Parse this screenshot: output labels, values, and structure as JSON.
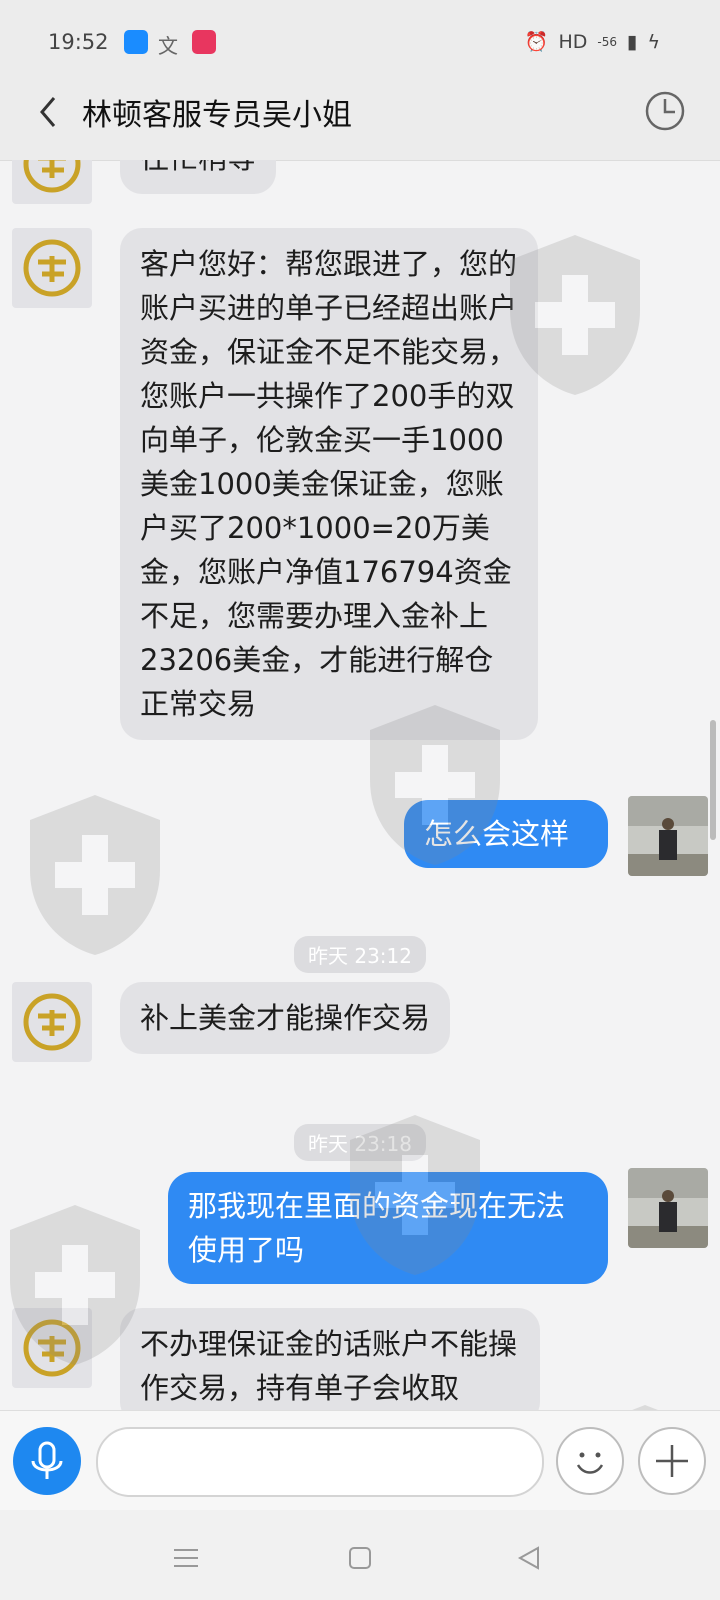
{
  "status_bar": {
    "time": "19:52",
    "right_text": "HD",
    "signal_text": "-56"
  },
  "header": {
    "title": "林顿客服专员吴小姐"
  },
  "messages": {
    "m0": {
      "text": "往忙稍等"
    },
    "m1": {
      "text": "客户您好：帮您跟进了，您的账户买进的单子已经超出账户资金，保证金不足不能交易，您账户一共操作了200手的双向单子，伦敦金买一手1000美金1000美金保证金，您账户买了200*1000=20万美金，您账户净值176794资金不足，您需要办理入金补上23206美金，才能进行解仓 正常交易"
    },
    "m2": {
      "text": "怎么会这样"
    },
    "t1": {
      "text": "昨天 23:12"
    },
    "m3": {
      "text": "补上美金才能操作交易"
    },
    "t2": {
      "text": "昨天 23:18"
    },
    "m4": {
      "text": "那我现在里面的资金现在无法使用了吗"
    },
    "m5": {
      "text": "不办理保证金的话账户不能操作交易，持有单子会收取"
    }
  },
  "input": {
    "placeholder": ""
  },
  "icons": {
    "back": "chevron-left-icon",
    "history": "clock-icon",
    "mic": "microphone-icon",
    "emoji": "smiley-icon",
    "plus": "plus-icon",
    "nav_menu": "menu-icon",
    "nav_home": "home-square-icon",
    "nav_back": "back-triangle-icon"
  },
  "colors": {
    "sent_bubble": "#2f8af3",
    "received_bubble": "#e2e2e5",
    "mic_button": "#1e88f0",
    "logo_gold": "#c9a227"
  }
}
